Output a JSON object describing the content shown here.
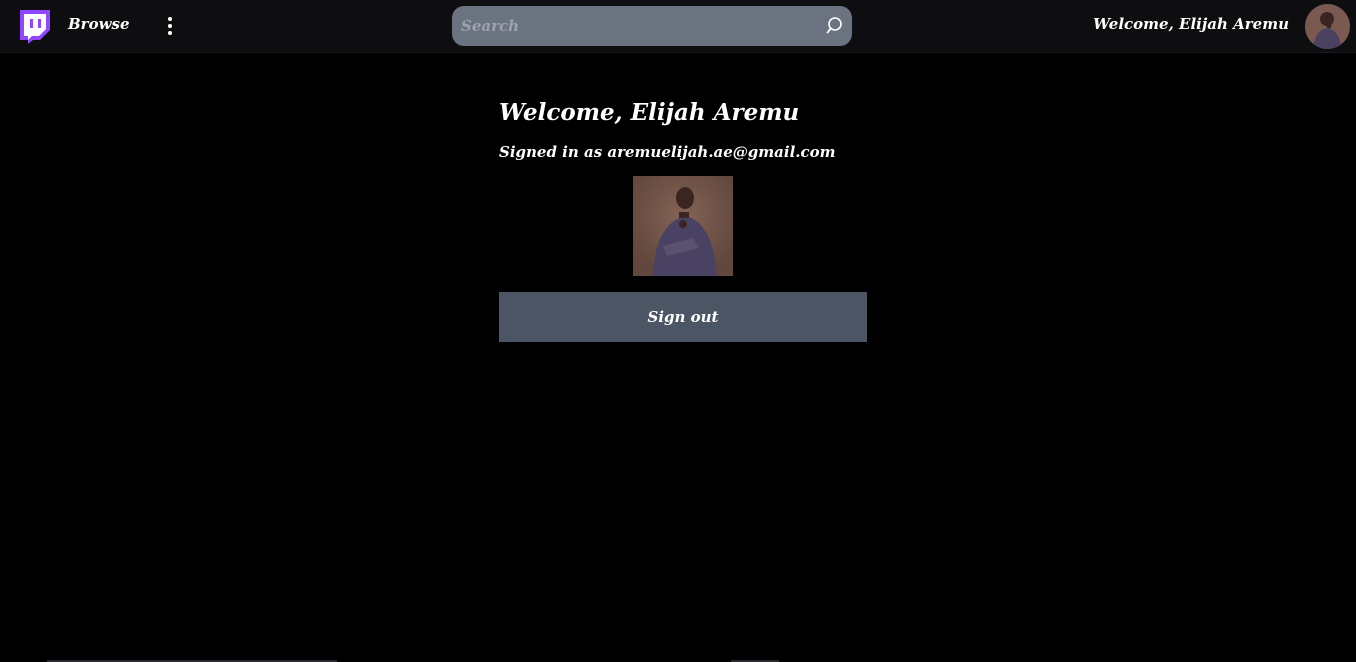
{
  "header": {
    "logo_icon": "twitch-logo-icon",
    "brand_color": "#9147ff",
    "browse_label": "Browse",
    "more_icon": "vertical-dots-icon",
    "search": {
      "placeholder": "Search",
      "value": "",
      "icon": "search-icon"
    },
    "welcome_text": "Welcome, Elijah Aremu",
    "avatar": "user-avatar"
  },
  "main": {
    "heading": "Welcome, Elijah Aremu",
    "signed_in_text": "Signed in as aremuelijah.ae@gmail.com",
    "profile_image": "user-profile-photo",
    "signout_label": "Sign out",
    "signout_color": "#4b5563"
  }
}
